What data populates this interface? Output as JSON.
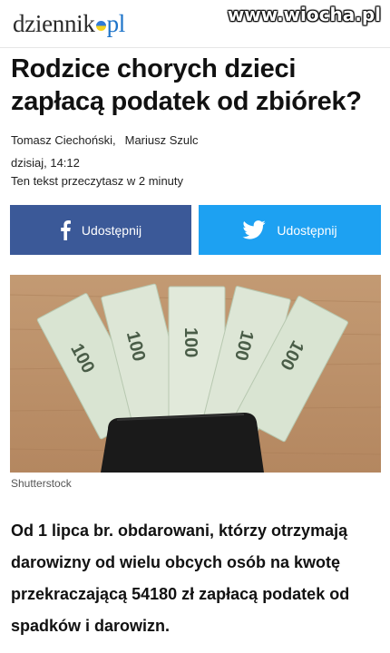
{
  "header": {
    "logo_text": "dziennik",
    "logo_suffix": "pl",
    "watermark": "www.wiocha.pl"
  },
  "article": {
    "headline": "Rodzice chorych dzieci zapłacą podatek od zbiórek?",
    "authors": [
      "Tomasz Ciechoński,",
      "Mariusz Szulc"
    ],
    "date": "dzisiaj, 14:12",
    "read_time": "Ten tekst przeczytasz w 2 minuty",
    "image_caption": "Shutterstock",
    "image_description": "100",
    "lead": "Od 1 lipca br. obdarowani, którzy otrzymają darowizny od wielu obcych osób na kwotę przekraczającą 54180 zł zapłacą podatek od spadków i darowizn."
  },
  "share": {
    "facebook_label": "Udostępnij",
    "twitter_label": "Udostępnij",
    "facebook_icon": "facebook-icon",
    "twitter_icon": "twitter-icon",
    "facebook_color": "#3b5998",
    "twitter_color": "#1da1f2"
  }
}
